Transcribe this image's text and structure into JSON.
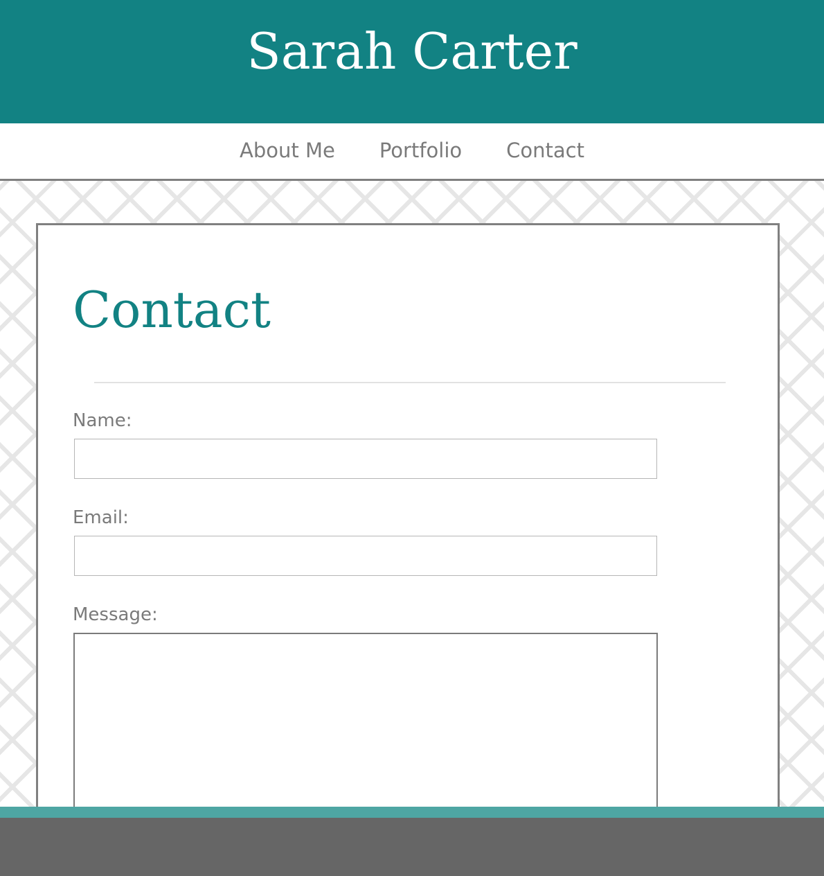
{
  "header": {
    "title": "Sarah Carter"
  },
  "nav": {
    "items": [
      {
        "label": "About Me"
      },
      {
        "label": "Portfolio"
      },
      {
        "label": "Contact"
      }
    ]
  },
  "main": {
    "heading": "Contact",
    "form": {
      "name_label": "Name:",
      "name_value": "",
      "email_label": "Email:",
      "email_value": "",
      "message_label": "Message:",
      "message_value": ""
    }
  },
  "colors": {
    "brand_teal": "#128283",
    "footer_accent": "#4ea6a3",
    "footer": "#666666",
    "nav_text": "#7a7a7a"
  }
}
